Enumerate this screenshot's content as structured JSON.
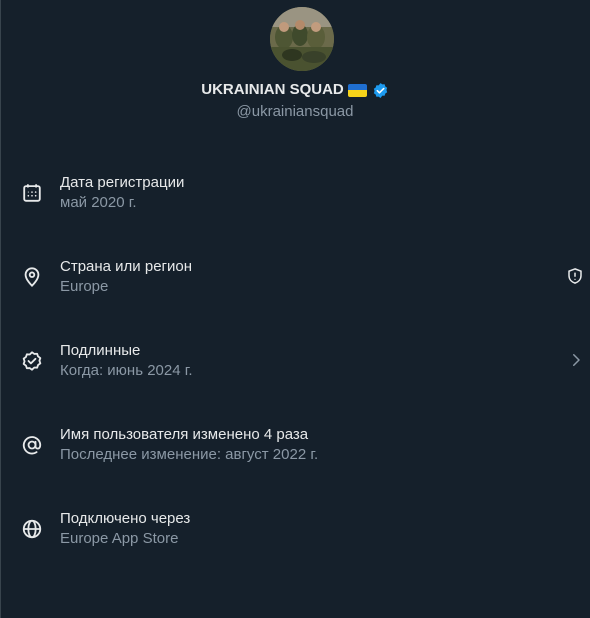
{
  "profile": {
    "display_name": "UKRAINIAN SQUAD",
    "handle": "@ukrainiansquad",
    "flag_icon": "ukraine-flag-icon",
    "verified_icon": "verified-badge-icon",
    "verified_color": "#1d9bf0"
  },
  "colors": {
    "background": "#15202b",
    "primary_text": "#e7e9ea",
    "secondary_text": "#8b98a5"
  },
  "about": [
    {
      "icon": "calendar-icon",
      "title": "Дата регистрации",
      "subtitle": "май 2020 г."
    },
    {
      "icon": "location-pin-icon",
      "title": "Страна или регион",
      "subtitle": "Europe",
      "trailing_icon": "shield-info-icon"
    },
    {
      "icon": "verified-check-icon",
      "title": "Подлинные",
      "subtitle": "Когда: июнь 2024 г.",
      "trailing_icon": "chevron-right-icon"
    },
    {
      "icon": "at-sign-icon",
      "title": "Имя пользователя изменено 4 раза",
      "subtitle": "Последнее изменение: август 2022 г."
    },
    {
      "icon": "globe-icon",
      "title": "Подключено через",
      "subtitle": "Europe App Store"
    }
  ]
}
